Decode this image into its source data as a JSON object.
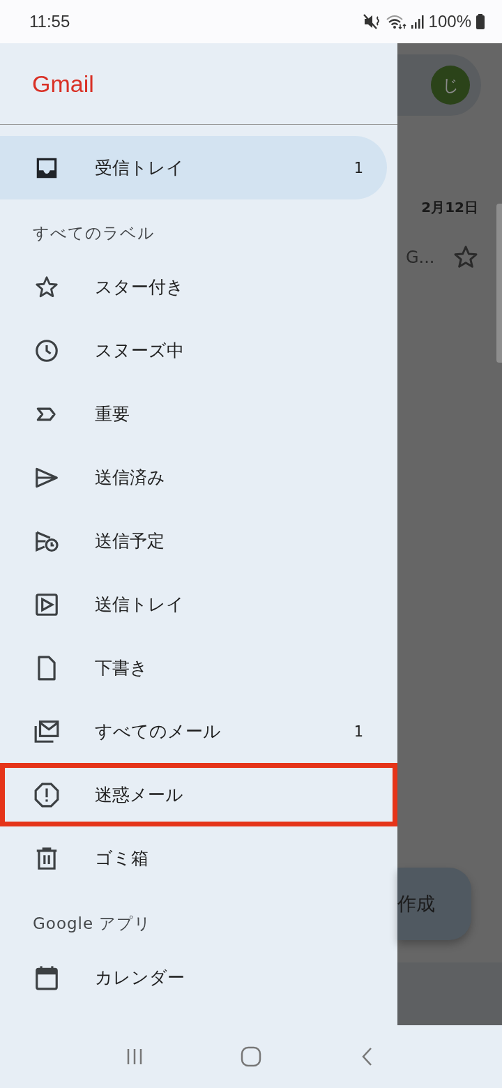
{
  "status_bar": {
    "time": "11:55",
    "battery": "100%"
  },
  "background": {
    "avatar": "じ",
    "date": "2月12日",
    "sender": "G...",
    "compose": "作成"
  },
  "drawer": {
    "title": "Gmail",
    "entries": [
      {
        "kind": "item",
        "label": "受信トレイ",
        "count": "1",
        "selected": true,
        "highlighted": false
      },
      {
        "kind": "section",
        "label": "すべてのラベル"
      },
      {
        "kind": "item",
        "label": "スター付き",
        "selected": false,
        "highlighted": false
      },
      {
        "kind": "item",
        "label": "スヌーズ中",
        "selected": false,
        "highlighted": false
      },
      {
        "kind": "item",
        "label": "重要",
        "selected": false,
        "highlighted": false
      },
      {
        "kind": "item",
        "label": "送信済み",
        "selected": false,
        "highlighted": false
      },
      {
        "kind": "item",
        "label": "送信予定",
        "selected": false,
        "highlighted": false
      },
      {
        "kind": "item",
        "label": "送信トレイ",
        "selected": false,
        "highlighted": false
      },
      {
        "kind": "item",
        "label": "下書き",
        "selected": false,
        "highlighted": false
      },
      {
        "kind": "item",
        "label": "すべてのメール",
        "count": "1",
        "selected": false,
        "highlighted": false
      },
      {
        "kind": "item",
        "label": "迷惑メール",
        "selected": false,
        "highlighted": true
      },
      {
        "kind": "item",
        "label": "ゴミ箱",
        "selected": false,
        "highlighted": false
      },
      {
        "kind": "section",
        "label": "Google アプリ"
      },
      {
        "kind": "item",
        "label": "カレンダー",
        "selected": false,
        "highlighted": false
      }
    ]
  }
}
